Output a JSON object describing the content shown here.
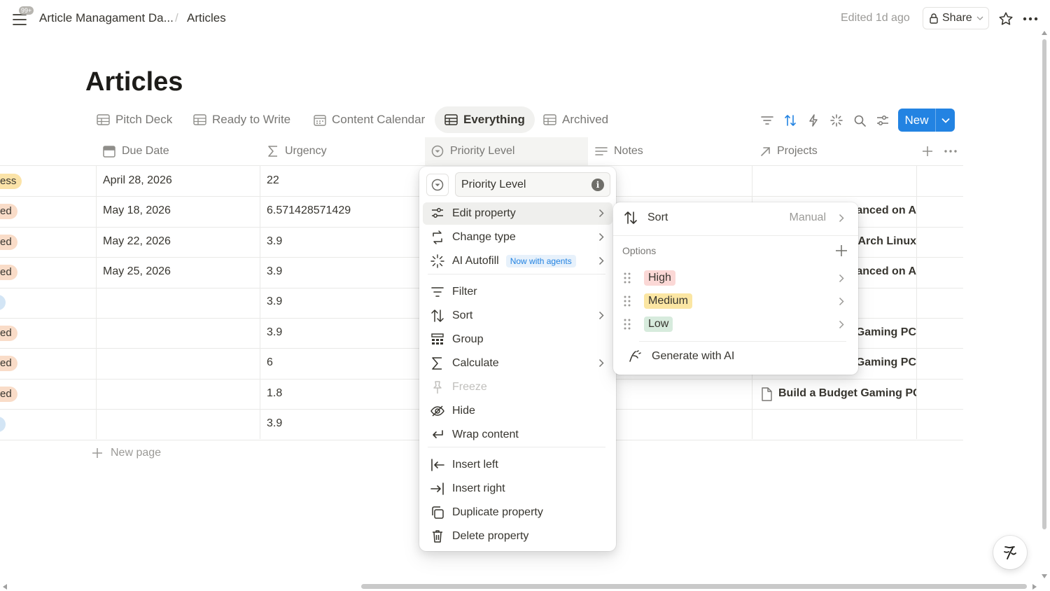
{
  "topbar": {
    "notification_count": "99+",
    "breadcrumb_workspace": "Article Managament Da...",
    "breadcrumb_sep": "/",
    "breadcrumb_page": "Articles",
    "edited": "Edited 1d ago",
    "share_label": "Share"
  },
  "page": {
    "title": "Articles"
  },
  "views": {
    "tabs": [
      {
        "label": "Pitch Deck",
        "icon": "table-icon"
      },
      {
        "label": "Ready to Write",
        "icon": "table-icon"
      },
      {
        "label": "Content Calendar",
        "icon": "calendar-icon"
      },
      {
        "label": "Everything",
        "icon": "table-icon",
        "active": true
      },
      {
        "label": "Archived",
        "icon": "table-icon"
      }
    ],
    "toolbar_icons": [
      "filter-icon",
      "sort-icon",
      "automation-icon",
      "ai-autofill-icon",
      "search-icon",
      "settings-icon"
    ],
    "new_label": "New"
  },
  "table": {
    "columns": [
      {
        "label": "Due Date",
        "icon": "calendar-icon"
      },
      {
        "label": "Urgency",
        "icon": "sigma-icon"
      },
      {
        "label": "Priority Level",
        "icon": "select-icon"
      },
      {
        "label": "Notes",
        "icon": "text-icon"
      },
      {
        "label": "Projects",
        "icon": "relation-icon"
      }
    ],
    "rows": [
      {
        "status": "ess",
        "status_color": "#fbe3a8",
        "due": "April 28, 2026",
        "urgency": "22",
        "project": ""
      },
      {
        "status": "ed",
        "status_color": "#f9dcc8",
        "due": "May 18, 2026",
        "urgency": "6.571428571429",
        "project": "vanced on A"
      },
      {
        "status": "ed",
        "status_color": "#f9dcc8",
        "due": "May 22, 2026",
        "urgency": "3.9",
        "project": "Arch Linux"
      },
      {
        "status": "ed",
        "status_color": "#f9dcc8",
        "due": "May 25, 2026",
        "urgency": "3.9",
        "project": "vanced on A"
      },
      {
        "status": "",
        "status_color": "#d3e5f5",
        "due": "",
        "urgency": "3.9",
        "project": ""
      },
      {
        "status": "ed",
        "status_color": "#f9dcc8",
        "due": "",
        "urgency": "3.9",
        "project": "Gaming PC"
      },
      {
        "status": "ed",
        "status_color": "#f9dcc8",
        "due": "",
        "urgency": "6",
        "project": "Gaming PC"
      },
      {
        "status": "ed",
        "status_color": "#f9dcc8",
        "due": "",
        "urgency": "1.8",
        "project": "Build a Budget Gaming PC"
      },
      {
        "status": "",
        "status_color": "#d3e5f5",
        "due": "",
        "urgency": "3.9",
        "project": ""
      }
    ],
    "new_page_label": "New page"
  },
  "property_menu": {
    "name_value": "Priority Level",
    "items": [
      {
        "label": "Edit property",
        "chevron": true,
        "highlight": true
      },
      {
        "label": "Change type",
        "chevron": true
      },
      {
        "label": "AI Autofill",
        "chevron": true,
        "badge": "Now with agents"
      },
      {
        "label": "Filter"
      },
      {
        "label": "Sort",
        "chevron": true
      },
      {
        "label": "Group"
      },
      {
        "label": "Calculate",
        "chevron": true
      },
      {
        "label": "Freeze",
        "disabled": true
      },
      {
        "label": "Hide"
      },
      {
        "label": "Wrap content"
      },
      {
        "label": "Insert left"
      },
      {
        "label": "Insert right"
      },
      {
        "label": "Duplicate property"
      },
      {
        "label": "Delete property"
      }
    ]
  },
  "edit_submenu": {
    "sort_label": "Sort",
    "sort_value": "Manual",
    "options_label": "Options",
    "options": [
      {
        "label": "High",
        "color": "#fbd8d6"
      },
      {
        "label": "Medium",
        "color": "#fbe6a3"
      },
      {
        "label": "Low",
        "color": "#d7ebdd"
      }
    ],
    "generate_label": "Generate with AI"
  }
}
